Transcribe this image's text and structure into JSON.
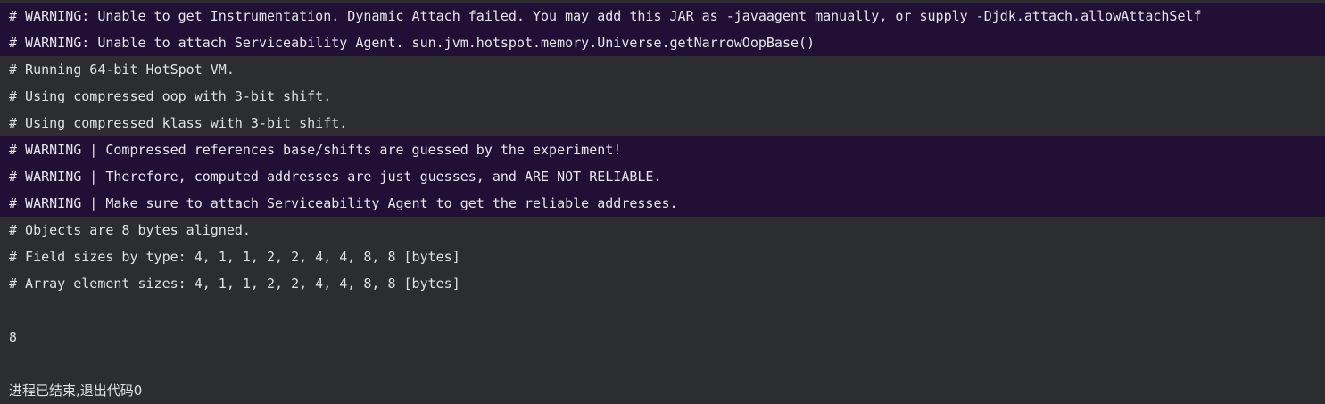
{
  "console": {
    "lines": [
      {
        "text": "# WARNING: Unable to get Instrumentation. Dynamic Attach failed. You may add this JAR as -javaagent manually, or supply -Djdk.attach.allowAttachSelf",
        "kind": "warning"
      },
      {
        "text": "# WARNING: Unable to attach Serviceability Agent. sun.jvm.hotspot.memory.Universe.getNarrowOopBase()",
        "kind": "warning"
      },
      {
        "text": "# Running 64-bit HotSpot VM.",
        "kind": "info"
      },
      {
        "text": "# Using compressed oop with 3-bit shift.",
        "kind": "info"
      },
      {
        "text": "# Using compressed klass with 3-bit shift.",
        "kind": "info"
      },
      {
        "text": "# WARNING | Compressed references base/shifts are guessed by the experiment!",
        "kind": "warning"
      },
      {
        "text": "# WARNING | Therefore, computed addresses are just guesses, and ARE NOT RELIABLE.",
        "kind": "warning"
      },
      {
        "text": "# WARNING | Make sure to attach Serviceability Agent to get the reliable addresses.",
        "kind": "warning"
      },
      {
        "text": "# Objects are 8 bytes aligned.",
        "kind": "info"
      },
      {
        "text": "# Field sizes by type: 4, 1, 1, 2, 2, 4, 4, 8, 8 [bytes]",
        "kind": "info"
      },
      {
        "text": "# Array element sizes: 4, 1, 1, 2, 2, 4, 4, 8, 8 [bytes]",
        "kind": "info"
      },
      {
        "text": "8",
        "kind": "output"
      },
      {
        "text": "进程已结束,退出代码0",
        "kind": "exit"
      }
    ]
  },
  "colors": {
    "background": "#2b2d30",
    "warning_highlight": "#210f35",
    "text": "#dfe1e5"
  }
}
